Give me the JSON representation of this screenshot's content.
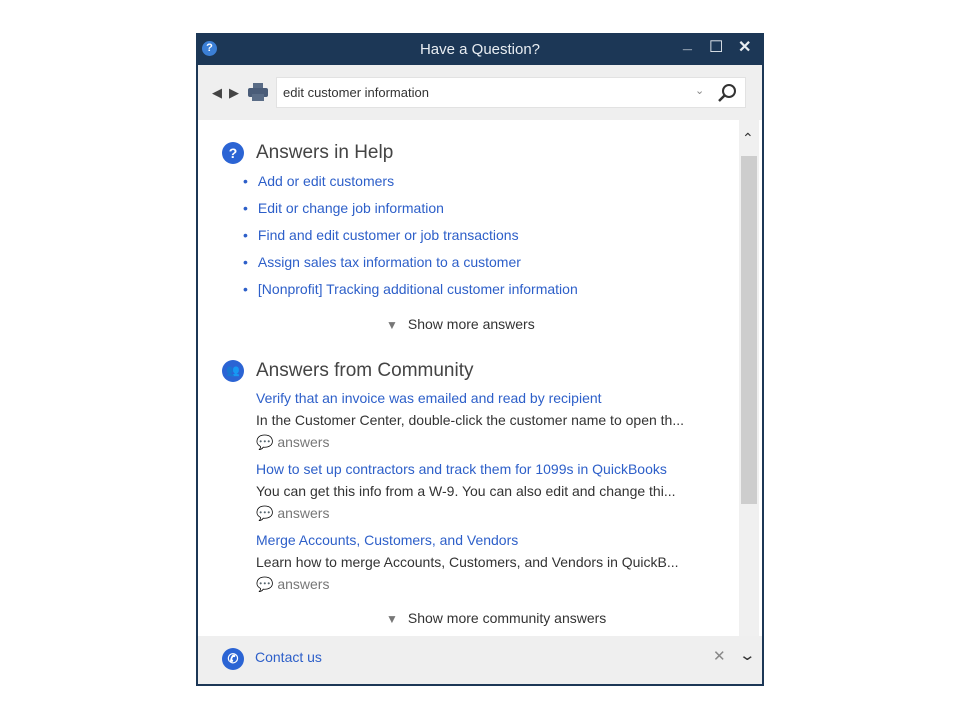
{
  "window": {
    "title": "Have a Question?",
    "minimize": "_",
    "maximize": "☐",
    "close": "✕"
  },
  "toolbar": {
    "search_value": "edit customer information"
  },
  "help": {
    "heading": "Answers in Help",
    "items": [
      "Add or edit customers",
      "Edit or change job information",
      "Find and edit customer or job transactions",
      "Assign sales tax information to a customer",
      "[Nonprofit] Tracking additional customer information"
    ],
    "show_more": "Show more answers"
  },
  "community": {
    "heading": "Answers from Community",
    "items": [
      {
        "title": "Verify that an invoice was emailed and read by recipient",
        "desc": "In the Customer Center, double-click the customer name to open th...",
        "meta": "answers"
      },
      {
        "title": "How to set up contractors and track them for 1099s in QuickBooks",
        "desc": "You can get this info from a W-9. You can also edit and change thi...",
        "meta": "answers"
      },
      {
        "title": "Merge Accounts, Customers, and Vendors",
        "desc": "Learn how to merge Accounts, Customers, and Vendors in QuickB...",
        "meta": "answers"
      }
    ],
    "show_more": "Show more community answers"
  },
  "footer": {
    "contact": "Contact us"
  },
  "colors": {
    "titlebar": "#1c3756",
    "link": "#2d5fc9",
    "accent": "#2b64d4"
  }
}
